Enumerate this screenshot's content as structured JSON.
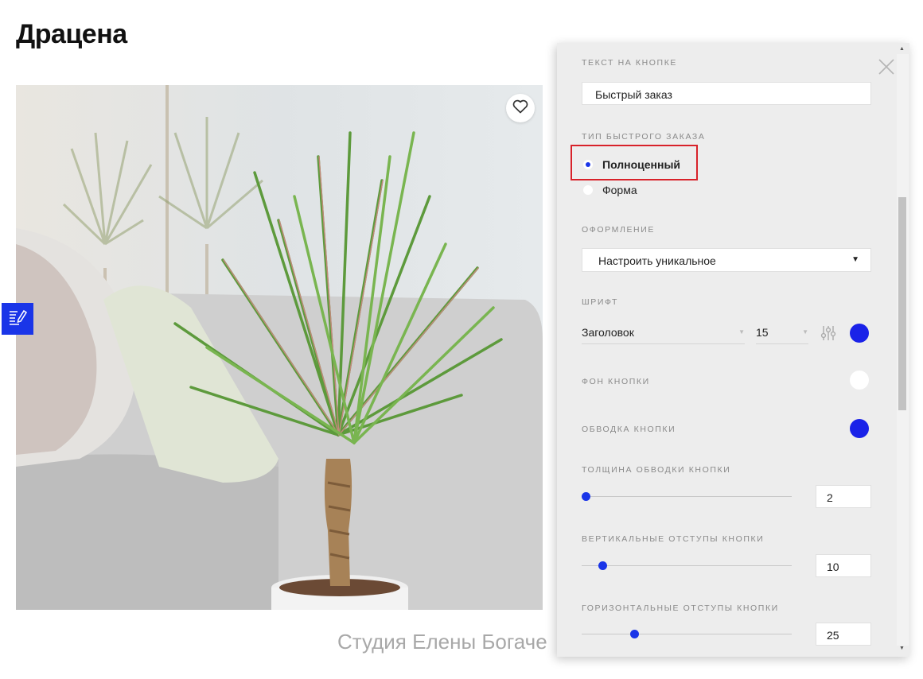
{
  "page": {
    "title": "Драцена",
    "caption": "Студия Елены Богаче"
  },
  "panel": {
    "button_text_label": "Текст на кнопке",
    "button_text_value": "Быстрый заказ",
    "order_type_label": "Тип быстрого заказа",
    "order_type_options": [
      {
        "label": "Полноценный",
        "selected": true
      },
      {
        "label": "Форма",
        "selected": false
      }
    ],
    "style_label": "Оформление",
    "style_value": "Настроить уникальное",
    "font_label": "Шрифт",
    "font_family": "Заголовок",
    "font_size": "15",
    "font_color": "#1a22e8",
    "button_bg_label": "Фон кнопки",
    "button_bg_color": "#ffffff",
    "button_border_label": "Обводка кнопки",
    "button_border_color": "#1a22e8",
    "sliders": [
      {
        "label": "Толщина обводки кнопки",
        "value": "2"
      },
      {
        "label": "Вертикальные отступы кнопки",
        "value": "10"
      },
      {
        "label": "Горизонтальные отступы кнопки",
        "value": "25"
      }
    ]
  },
  "colors": {
    "accent": "#1a35e8",
    "highlight": "#d8222a",
    "panel_bg": "#ededed"
  },
  "icons": [
    "heart-icon",
    "edit-icon",
    "close-icon",
    "dropdown-caret-icon",
    "font-settings-icon"
  ]
}
